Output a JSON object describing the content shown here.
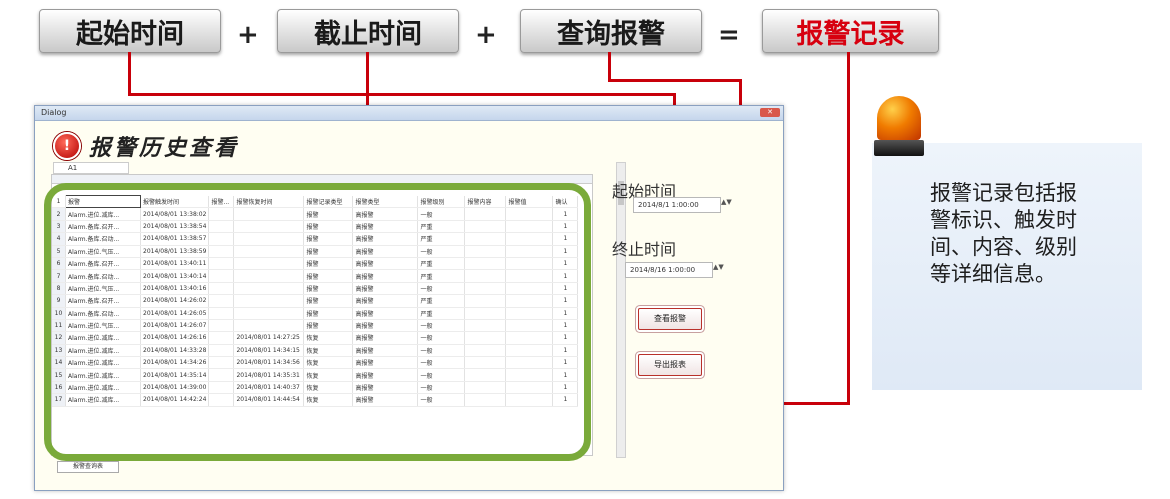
{
  "formula": {
    "start_time": "起始时间",
    "plus1": "+",
    "end_time": "截止时间",
    "plus2": "+",
    "query_alarm": "查询报警",
    "equals": "=",
    "alarm_record": "报警记录"
  },
  "dialog": {
    "title": "Dialog",
    "heading": "报警历史查看",
    "cell_ref": "A1",
    "sheet_tab": "报警查询表",
    "start_label": "起始时间",
    "start_value": "2014/8/1 1:00:00",
    "end_label": "终止时间",
    "end_value": "2014/8/16 1:00:00",
    "query_button": "查看报警",
    "export_button": "导出报表"
  },
  "table": {
    "headers": [
      "报警",
      "报警触发时间",
      "报警...",
      "报警恢复时间",
      "报警记录类型",
      "报警类型",
      "报警级别",
      "报警内容",
      "报警值",
      "确认"
    ],
    "rows": [
      [
        "Alarm.进位.减库...",
        "2014/08/01 13:38:02",
        "",
        "",
        "报警",
        "高报警",
        "一般",
        "",
        "",
        "1"
      ],
      [
        "Alarm.备库.召开...",
        "2014/08/01 13:38:54",
        "",
        "",
        "报警",
        "高报警",
        "严重",
        "",
        "",
        "1"
      ],
      [
        "Alarm.备库.召动...",
        "2014/08/01 13:38:57",
        "",
        "",
        "报警",
        "高报警",
        "严重",
        "",
        "",
        "1"
      ],
      [
        "Alarm.进位.气压...",
        "2014/08/01 13:38:59",
        "",
        "",
        "报警",
        "高报警",
        "一般",
        "",
        "",
        "1"
      ],
      [
        "Alarm.备库.召开...",
        "2014/08/01 13:40:11",
        "",
        "",
        "报警",
        "高报警",
        "严重",
        "",
        "",
        "1"
      ],
      [
        "Alarm.备库.召动...",
        "2014/08/01 13:40:14",
        "",
        "",
        "报警",
        "高报警",
        "严重",
        "",
        "",
        "1"
      ],
      [
        "Alarm.进位.气压...",
        "2014/08/01 13:40:16",
        "",
        "",
        "报警",
        "高报警",
        "一般",
        "",
        "",
        "1"
      ],
      [
        "Alarm.备库.召开...",
        "2014/08/01 14:26:02",
        "",
        "",
        "报警",
        "高报警",
        "严重",
        "",
        "",
        "1"
      ],
      [
        "Alarm.备库.召动...",
        "2014/08/01 14:26:05",
        "",
        "",
        "报警",
        "高报警",
        "严重",
        "",
        "",
        "1"
      ],
      [
        "Alarm.进位.气压...",
        "2014/08/01 14:26:07",
        "",
        "",
        "报警",
        "高报警",
        "一般",
        "",
        "",
        "1"
      ],
      [
        "Alarm.进位.减库...",
        "2014/08/01 14:26:16",
        "",
        "2014/08/01 14:27:25",
        "恢复",
        "高报警",
        "一般",
        "",
        "",
        "1"
      ],
      [
        "Alarm.进位.减库...",
        "2014/08/01 14:33:28",
        "",
        "2014/08/01 14:34:15",
        "恢复",
        "高报警",
        "一般",
        "",
        "",
        "1"
      ],
      [
        "Alarm.进位.减库...",
        "2014/08/01 14:34:26",
        "",
        "2014/08/01 14:34:56",
        "恢复",
        "高报警",
        "一般",
        "",
        "",
        "1"
      ],
      [
        "Alarm.进位.减库...",
        "2014/08/01 14:35:14",
        "",
        "2014/08/01 14:35:31",
        "恢复",
        "高报警",
        "一般",
        "",
        "",
        "1"
      ],
      [
        "Alarm.进位.减库...",
        "2014/08/01 14:39:00",
        "",
        "2014/08/01 14:40:37",
        "恢复",
        "高报警",
        "一般",
        "",
        "",
        "1"
      ],
      [
        "Alarm.进位.减库...",
        "2014/08/01 14:42:24",
        "",
        "2014/08/01 14:44:54",
        "恢复",
        "高报警",
        "一般",
        "",
        "",
        "1"
      ]
    ]
  },
  "info_text": "报警记录包括报警标识、触发时间、内容、级别等详细信息。",
  "colors": {
    "accent_red": "#c8000a",
    "result_red": "#d7000f",
    "frame_green": "#7aaa3a"
  }
}
